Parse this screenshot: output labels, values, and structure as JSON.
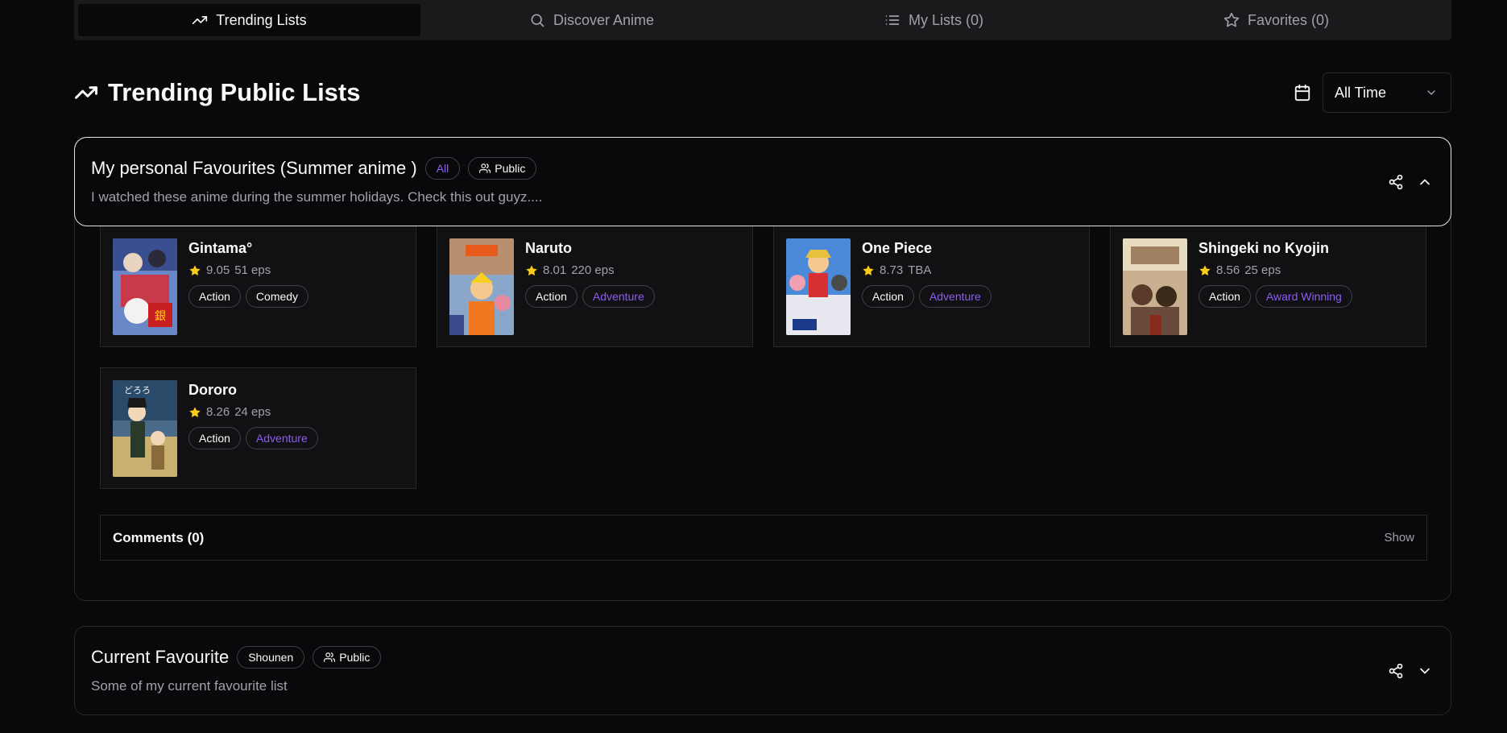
{
  "tabs": [
    {
      "label": "Trending Lists",
      "icon": "trending-up-icon",
      "active": true
    },
    {
      "label": "Discover Anime",
      "icon": "search-icon",
      "active": false
    },
    {
      "label": "My Lists (0)",
      "icon": "list-icon",
      "active": false
    },
    {
      "label": "Favorites (0)",
      "icon": "star-icon",
      "active": false
    }
  ],
  "header": {
    "title": "Trending Public Lists",
    "time_filter": "All Time"
  },
  "lists": [
    {
      "title": "My personal Favourites (Summer anime )",
      "category": "All",
      "visibility": "Public",
      "description": "I watched these anime during the summer holidays. Check this out guyz....",
      "items": [
        {
          "name": "Gintama°",
          "score": "9.05",
          "episodes": "51 eps",
          "genres": [
            "Action",
            "Comedy"
          ],
          "poster": "gintama-poster"
        },
        {
          "name": "Naruto",
          "score": "8.01",
          "episodes": "220 eps",
          "genres": [
            "Action",
            "Adventure"
          ],
          "poster": "naruto-poster"
        },
        {
          "name": "One Piece",
          "score": "8.73",
          "episodes": "TBA",
          "genres": [
            "Action",
            "Adventure"
          ],
          "poster": "one-piece-poster"
        },
        {
          "name": "Shingeki no Kyojin",
          "score": "8.56",
          "episodes": "25 eps",
          "genres": [
            "Action",
            "Award Winning"
          ],
          "poster": "shingeki-poster"
        },
        {
          "name": "Dororo",
          "score": "8.26",
          "episodes": "24 eps",
          "genres": [
            "Action",
            "Adventure"
          ],
          "poster": "dororo-poster"
        }
      ],
      "comments_label": "Comments (0)",
      "comments_toggle": "Show"
    },
    {
      "title": "Current Favourite",
      "category": "Shounen",
      "visibility": "Public",
      "description": "Some of my current favourite list"
    }
  ],
  "colors": {
    "background": "#09090b",
    "accent_purple": "#8b5cf6",
    "star": "#facc15"
  }
}
